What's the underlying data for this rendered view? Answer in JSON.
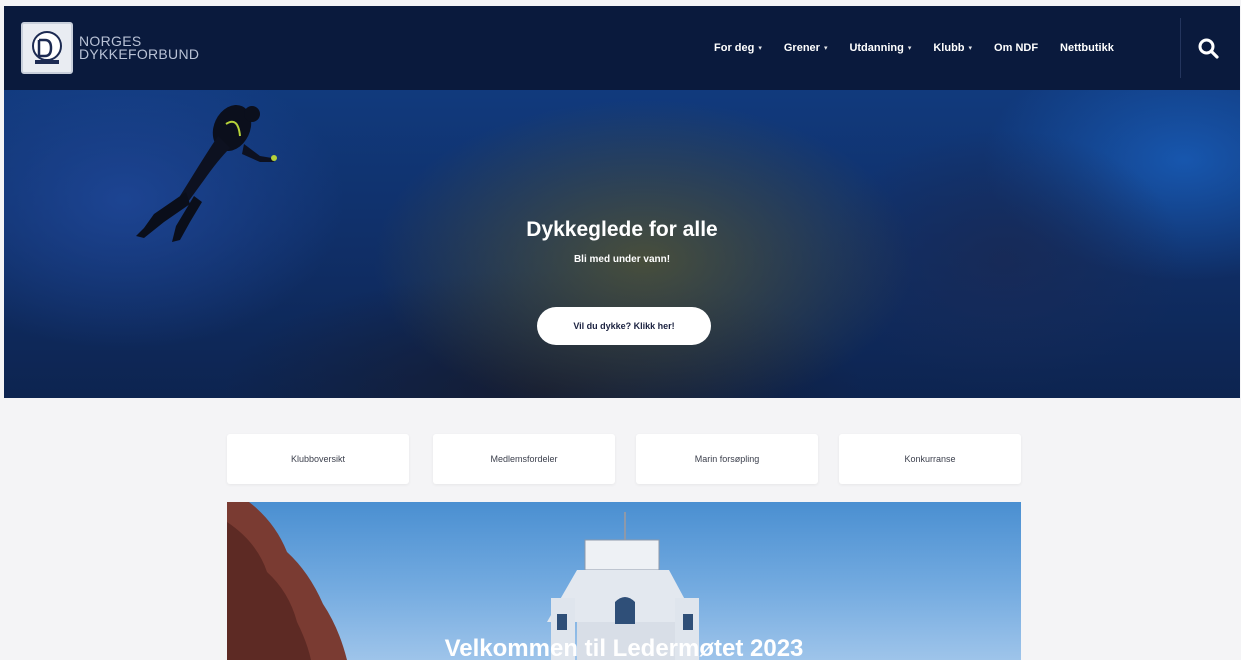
{
  "header": {
    "logo_line1": "NORGES",
    "logo_line2": "DYKKEFORBUND",
    "nav": [
      {
        "label": "For deg",
        "has_dropdown": true
      },
      {
        "label": "Grener",
        "has_dropdown": true
      },
      {
        "label": "Utdanning",
        "has_dropdown": true
      },
      {
        "label": "Klubb",
        "has_dropdown": true
      },
      {
        "label": "Om NDF",
        "has_dropdown": false
      },
      {
        "label": "Nettbutikk",
        "has_dropdown": false
      }
    ],
    "search_icon": "search-icon",
    "dropdown_glyph": "▾"
  },
  "hero": {
    "title": "Dykkeglede for alle",
    "subtitle": "Bli med under vann!",
    "cta_label": "Vil du dykke? Klikk her!"
  },
  "quick_links": [
    {
      "label": "Klubboversikt"
    },
    {
      "label": "Medlemsfordeler"
    },
    {
      "label": "Marin forsøpling"
    },
    {
      "label": "Konkurranse"
    }
  ],
  "feature": {
    "title": "Velkommen til Ledermøtet 2023"
  },
  "colors": {
    "header_bg": "#0a1a3d",
    "page_bg": "#f4f4f6",
    "hero_deep_blue": "#10306a",
    "cta_bg": "#ffffff"
  }
}
